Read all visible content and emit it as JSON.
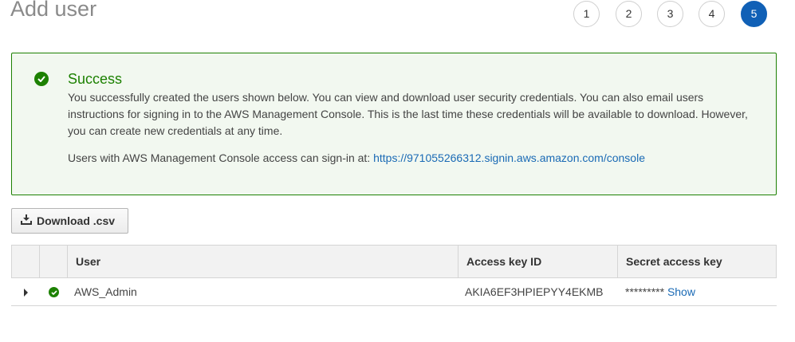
{
  "page": {
    "title": "Add user"
  },
  "steps": [
    "1",
    "2",
    "3",
    "4",
    "5"
  ],
  "active_step": "5",
  "alert": {
    "title": "Success",
    "message": "You successfully created the users shown below. You can view and download user security credentials. You can also email users instructions for signing in to the AWS Management Console. This is the last time these credentials will be available to download. However, you can create new credentials at any time.",
    "signin_prefix": "Users with AWS Management Console access can sign-in at:",
    "signin_url": "https://971055266312.signin.aws.amazon.com/console"
  },
  "toolbar": {
    "download_label": "Download .csv"
  },
  "table": {
    "columns": [
      "User",
      "Access key ID",
      "Secret access key"
    ],
    "rows": [
      {
        "user": "AWS_Admin",
        "access_key_id": "AKIA6EF3HPIEPYY4EKMB",
        "secret_masked": "*********",
        "show_label": "Show"
      }
    ]
  },
  "colors": {
    "success": "#1d8102",
    "link": "#1a6ab5",
    "active_step": "#1060b6"
  }
}
